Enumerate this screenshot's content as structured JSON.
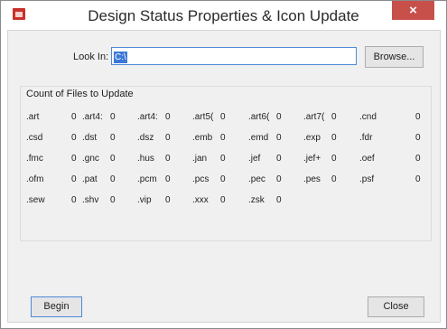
{
  "window": {
    "title": "Design Status Properties & Icon Update",
    "close_glyph": "×"
  },
  "lookin": {
    "label": "Look In:",
    "value": "C:\\"
  },
  "buttons": {
    "browse": "Browse...",
    "begin": "Begin",
    "close": "Close"
  },
  "group": {
    "label": "Count of Files to Update"
  },
  "file_counts": [
    [
      {
        "ext": ".art",
        "count": "0"
      },
      {
        "ext": ".art4:",
        "count": "0"
      },
      {
        "ext": ".art4:",
        "count": "0"
      },
      {
        "ext": ".art5(",
        "count": "0"
      },
      {
        "ext": ".art6(",
        "count": "0"
      },
      {
        "ext": ".art7(",
        "count": "0"
      },
      {
        "ext": ".cnd",
        "count": "0"
      }
    ],
    [
      {
        "ext": ".csd",
        "count": "0"
      },
      {
        "ext": ".dst",
        "count": "0"
      },
      {
        "ext": ".dsz",
        "count": "0"
      },
      {
        "ext": ".emb",
        "count": "0"
      },
      {
        "ext": ".emd",
        "count": "0"
      },
      {
        "ext": ".exp",
        "count": "0"
      },
      {
        "ext": ".fdr",
        "count": "0"
      }
    ],
    [
      {
        "ext": ".fmc",
        "count": "0"
      },
      {
        "ext": ".gnc",
        "count": "0"
      },
      {
        "ext": ".hus",
        "count": "0"
      },
      {
        "ext": ".jan",
        "count": "0"
      },
      {
        "ext": ".jef",
        "count": "0"
      },
      {
        "ext": ".jef+",
        "count": "0"
      },
      {
        "ext": ".oef",
        "count": "0"
      }
    ],
    [
      {
        "ext": ".ofm",
        "count": "0"
      },
      {
        "ext": ".pat",
        "count": "0"
      },
      {
        "ext": ".pcm",
        "count": "0"
      },
      {
        "ext": ".pcs",
        "count": "0"
      },
      {
        "ext": ".pec",
        "count": "0"
      },
      {
        "ext": ".pes",
        "count": "0"
      },
      {
        "ext": ".psf",
        "count": "0"
      }
    ],
    [
      {
        "ext": ".sew",
        "count": "0"
      },
      {
        "ext": ".shv",
        "count": "0"
      },
      {
        "ext": ".vip",
        "count": "0"
      },
      {
        "ext": ".xxx",
        "count": "0"
      },
      {
        "ext": ".zsk",
        "count": "0"
      }
    ]
  ],
  "colors": {
    "close_accent": "#c7504b",
    "focus_blue": "#4d8ad6",
    "selection_blue": "#3b78d8"
  },
  "icons": {
    "app": "app-icon",
    "close": "close-icon"
  }
}
